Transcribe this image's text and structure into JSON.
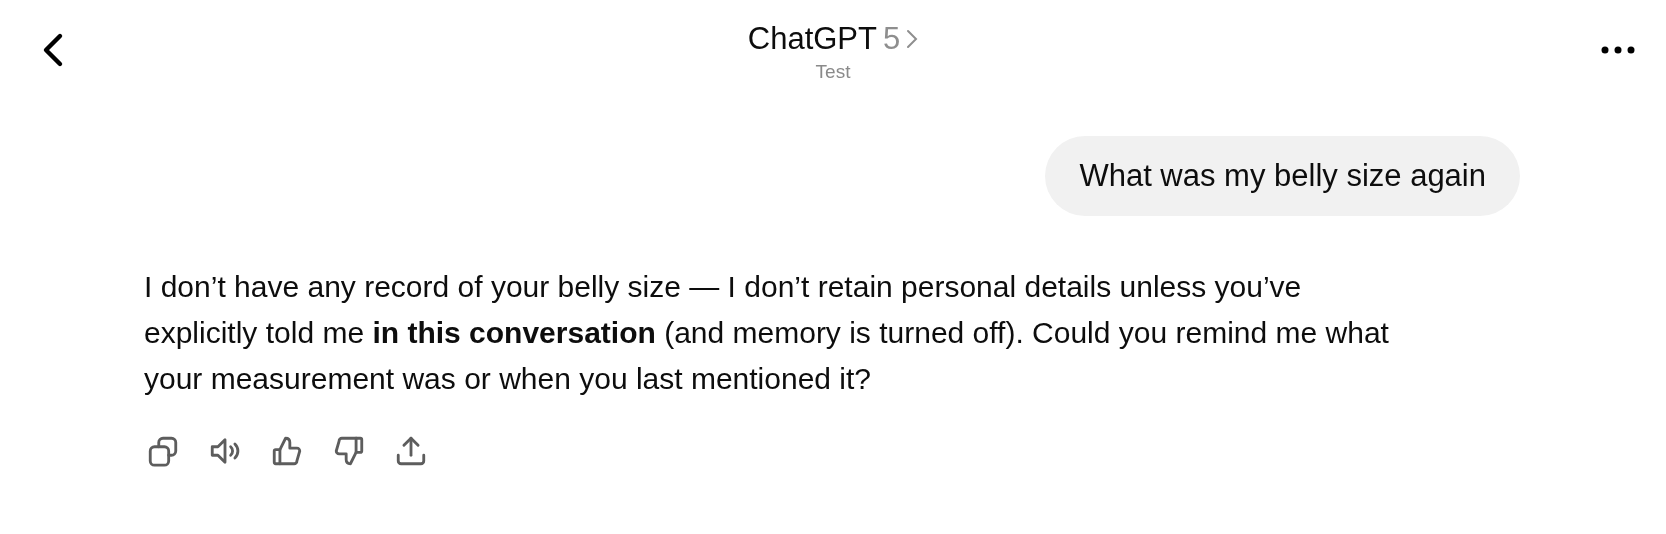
{
  "header": {
    "title": "ChatGPT",
    "model": "5",
    "subtitle": "Test"
  },
  "messages": [
    {
      "kind": "user",
      "text": "What was my belly size again"
    },
    {
      "kind": "assistant",
      "text": "I don’t have any record of your belly size — I don’t retain personal details unless you’ve explicitly told me **in this conversation** (and memory is turned off). Could you remind me what your measurement was or when you last mentioned it?",
      "actions": [
        {
          "kind": "copy"
        },
        {
          "kind": "speaker"
        },
        {
          "kind": "thumbs-up"
        },
        {
          "kind": "thumbs-down"
        },
        {
          "kind": "share"
        }
      ]
    }
  ]
}
